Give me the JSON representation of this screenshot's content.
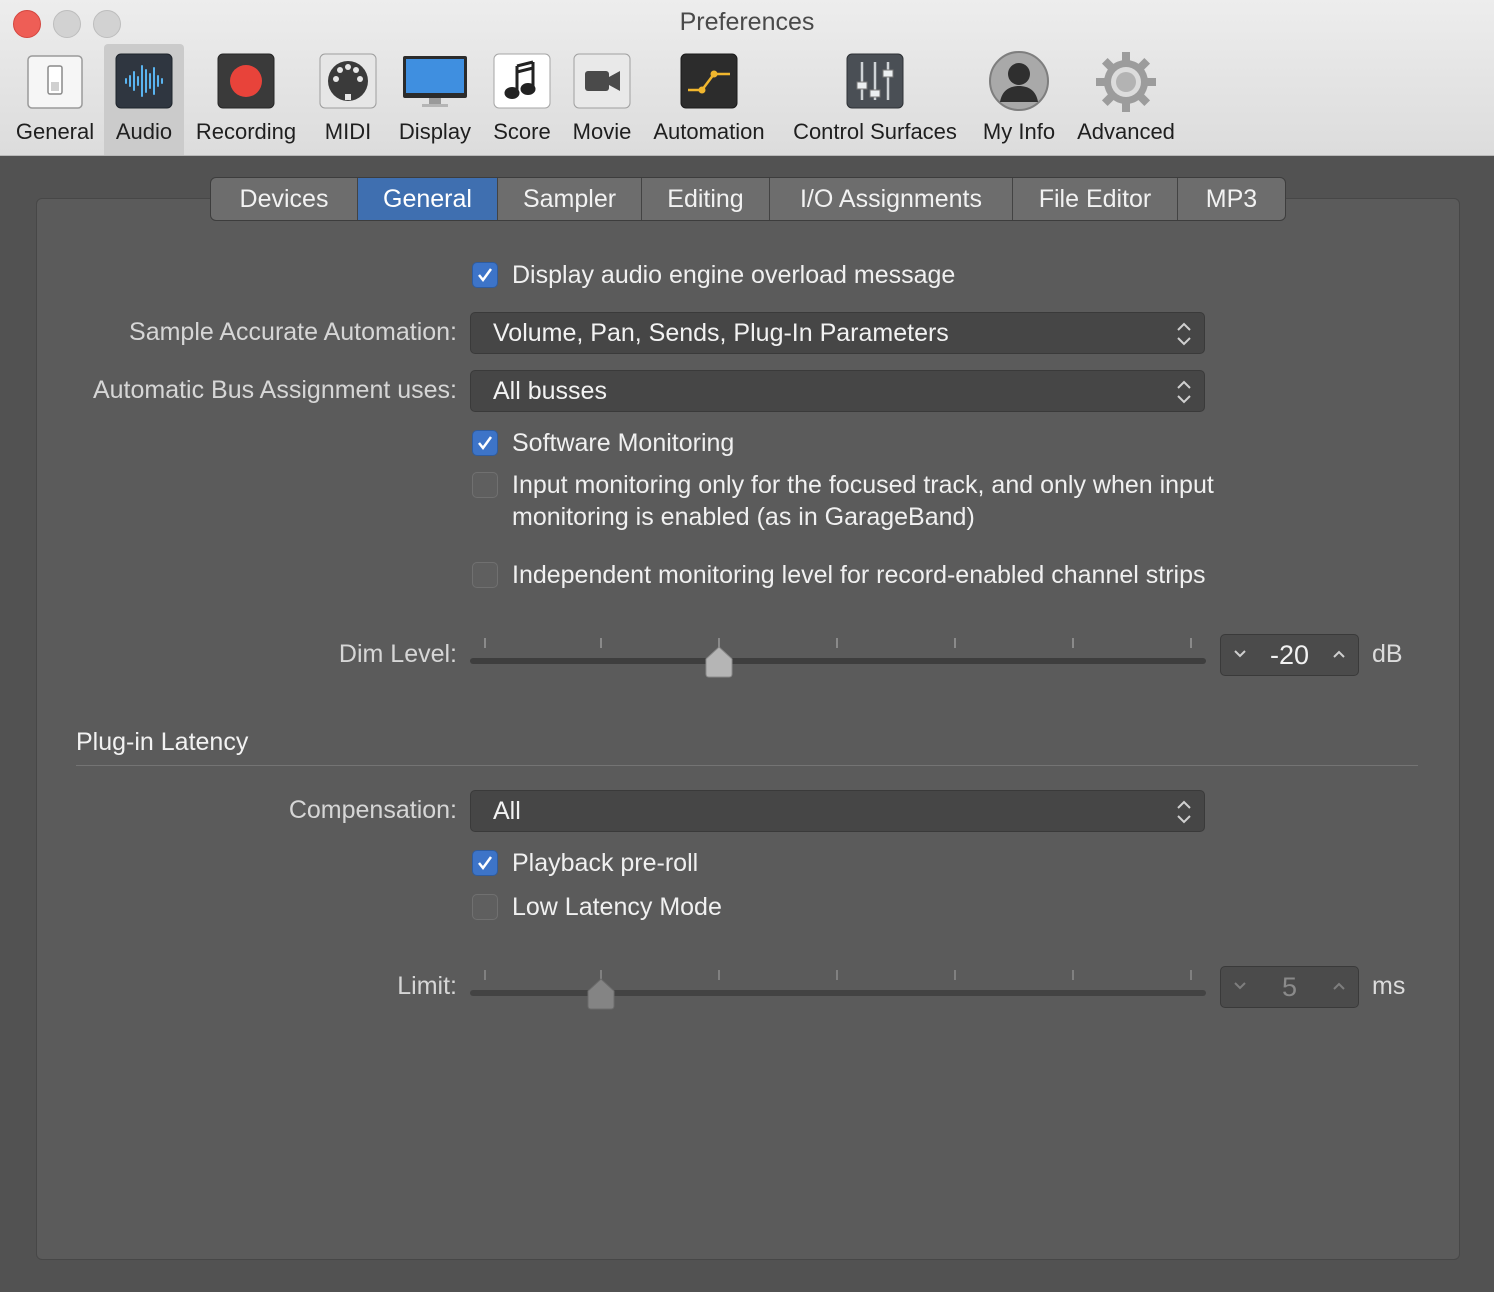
{
  "window": {
    "title": "Preferences"
  },
  "toolbar": {
    "items": [
      {
        "label": "General",
        "icon": "switch-icon"
      },
      {
        "label": "Audio",
        "icon": "waveform-icon",
        "selected": true
      },
      {
        "label": "Recording",
        "icon": "record-icon"
      },
      {
        "label": "MIDI",
        "icon": "midi-connector-icon"
      },
      {
        "label": "Display",
        "icon": "monitor-icon"
      },
      {
        "label": "Score",
        "icon": "music-note-icon"
      },
      {
        "label": "Movie",
        "icon": "video-camera-icon"
      },
      {
        "label": "Automation",
        "icon": "automation-curve-icon"
      },
      {
        "label": "Control Surfaces",
        "icon": "faders-icon"
      },
      {
        "label": "My Info",
        "icon": "user-silhouette-icon"
      },
      {
        "label": "Advanced",
        "icon": "gear-icon"
      }
    ]
  },
  "tabs": [
    {
      "label": "Devices"
    },
    {
      "label": "General",
      "selected": true
    },
    {
      "label": "Sampler"
    },
    {
      "label": "Editing"
    },
    {
      "label": "I/O Assignments"
    },
    {
      "label": "File Editor"
    },
    {
      "label": "MP3"
    }
  ],
  "general": {
    "overload_message": {
      "label": "Display audio engine overload message",
      "checked": true
    },
    "sample_accurate_automation": {
      "label": "Sample Accurate Automation:",
      "value": "Volume, Pan, Sends, Plug-In Parameters"
    },
    "bus_assignment": {
      "label": "Automatic Bus Assignment uses:",
      "value": "All busses"
    },
    "software_monitoring": {
      "label": "Software Monitoring",
      "checked": true
    },
    "input_monitoring": {
      "line1": "Input monitoring only for the focused track, and only when input",
      "line2": "monitoring is enabled (as in GarageBand)",
      "checked": false
    },
    "independent_monitoring": {
      "label": "Independent monitoring level for record-enabled channel strips",
      "checked": false
    },
    "dim_level": {
      "label": "Dim Level:",
      "value": "-20",
      "unit": "dB"
    }
  },
  "plugin_latency": {
    "title": "Plug-in Latency",
    "compensation": {
      "label": "Compensation:",
      "value": "All"
    },
    "playback_preroll": {
      "label": "Playback pre-roll",
      "checked": true
    },
    "low_latency_mode": {
      "label": "Low Latency Mode",
      "checked": false
    },
    "limit": {
      "label": "Limit:",
      "value": "5",
      "unit": "ms"
    }
  },
  "colors": {
    "accent": "#3d74c8",
    "panel": "#5b5b5b",
    "record": "#e8433a",
    "automation": "#f0b62e"
  }
}
